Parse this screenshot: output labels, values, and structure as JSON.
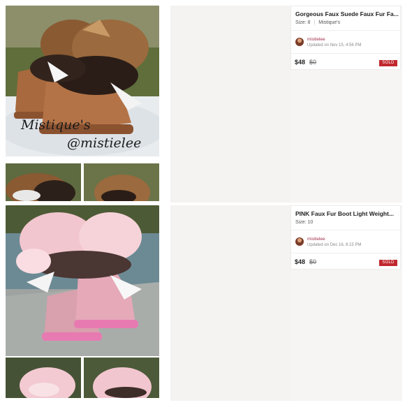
{
  "listings": [
    {
      "title": "Gorgeous Faux Suede Faux Fur Fa...",
      "size_label": "Size: 8",
      "brand": "Mistique's",
      "seller": "mistielee",
      "updated": "Updated on Nov 15, 4:56 PM",
      "price": "$48",
      "original_price": "$0",
      "badge": "SOLD",
      "watermark_name": "Mistique's",
      "watermark_handle": "@mistielee",
      "boot_color": "#a8693e",
      "fur_color": "#8a5a33"
    },
    {
      "title": "PINK Faux Fur Boot Light Weight...",
      "size_label": "Size: 10",
      "seller": "mistielee",
      "updated": "Updated on Dec 16, 8:15 PM",
      "price": "$48",
      "original_price": "$0",
      "badge": "SOLD",
      "boot_color": "#e5a9b8",
      "fur_color": "#f2c6cf"
    }
  ],
  "colors": {
    "sold_badge": "#c0282e",
    "seller_link": "#a0304a"
  }
}
